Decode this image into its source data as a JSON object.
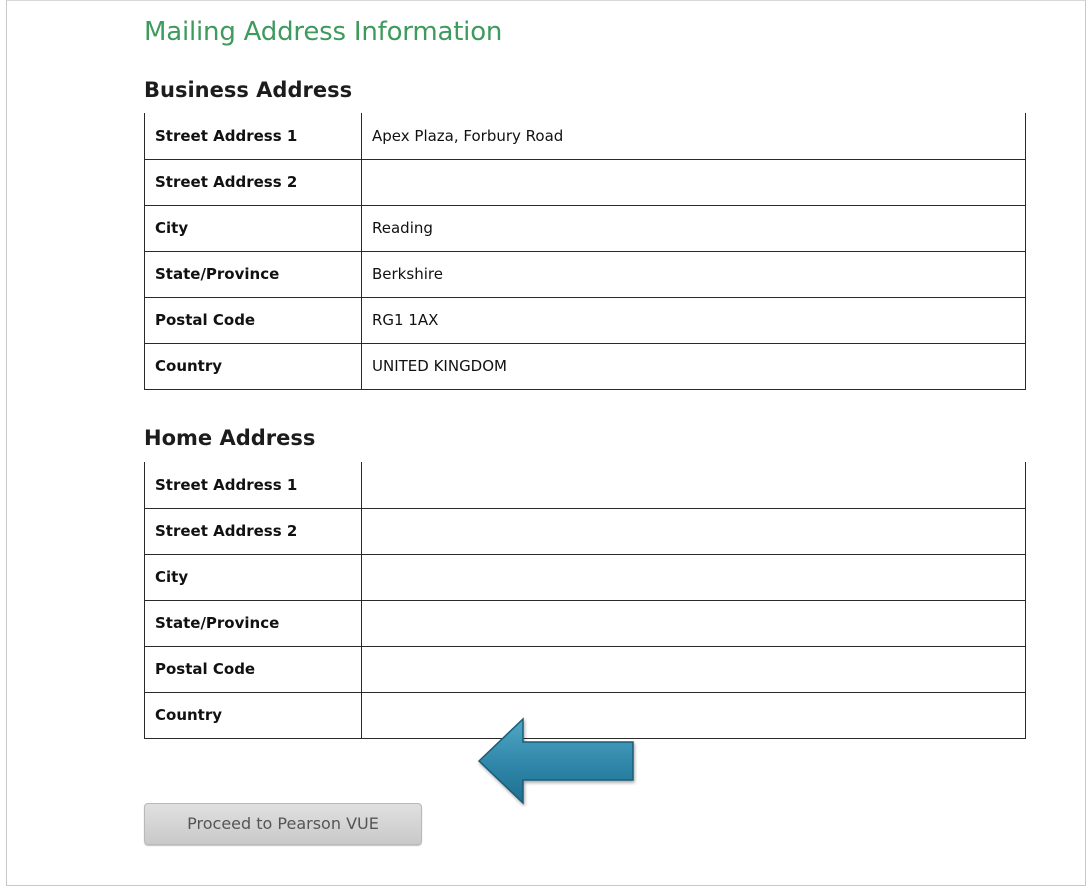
{
  "page": {
    "title": "Mailing Address Information"
  },
  "business": {
    "title": "Business Address",
    "rows": [
      {
        "label": "Street Address 1",
        "value": "Apex Plaza, Forbury Road"
      },
      {
        "label": "Street Address 2",
        "value": ""
      },
      {
        "label": "City",
        "value": "Reading"
      },
      {
        "label": "State/Province",
        "value": "Berkshire"
      },
      {
        "label": "Postal Code",
        "value": "RG1 1AX"
      },
      {
        "label": "Country",
        "value": "UNITED KINGDOM"
      }
    ]
  },
  "home": {
    "title": "Home Address",
    "rows": [
      {
        "label": "Street Address 1",
        "value": ""
      },
      {
        "label": "Street Address 2",
        "value": ""
      },
      {
        "label": "City",
        "value": ""
      },
      {
        "label": "State/Province",
        "value": ""
      },
      {
        "label": "Postal Code",
        "value": ""
      },
      {
        "label": "Country",
        "value": ""
      }
    ]
  },
  "annotation": {
    "icon": "left-arrow-icon",
    "color": "#2f86a8"
  },
  "actions": {
    "proceed_label": "Proceed to Pearson VUE"
  },
  "colors": {
    "title_green": "#3f9a5d"
  }
}
